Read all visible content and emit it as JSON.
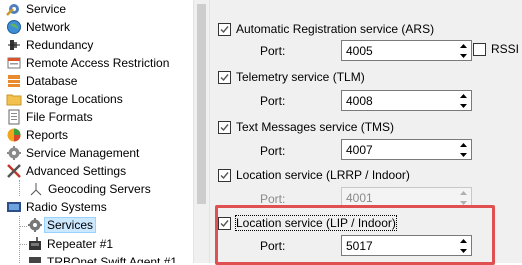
{
  "tree": {
    "items": [
      {
        "label": "Service",
        "icon": "gear-icon"
      },
      {
        "label": "Network",
        "icon": "globe-icon"
      },
      {
        "label": "Redundancy",
        "icon": "redundancy-icon"
      },
      {
        "label": "Remote Access Restriction",
        "icon": "remote-access-icon"
      },
      {
        "label": "Database",
        "icon": "database-icon"
      },
      {
        "label": "Storage Locations",
        "icon": "folder-icon"
      },
      {
        "label": "File Formats",
        "icon": "file-icon"
      },
      {
        "label": "Reports",
        "icon": "reports-icon"
      },
      {
        "label": "Service Management",
        "icon": "gear-icon"
      },
      {
        "label": "Advanced Settings",
        "icon": "tools-icon"
      },
      {
        "label": "Geocoding Servers",
        "icon": "geocoding-icon"
      },
      {
        "label": "Radio Systems",
        "icon": "radio-system-icon"
      },
      {
        "label": "Services",
        "icon": "gear-icon"
      },
      {
        "label": "Repeater #1",
        "icon": "repeater-icon"
      },
      {
        "label": "TRBOnet Swift Agent #1",
        "icon": "agent-icon"
      }
    ]
  },
  "services": [
    {
      "label": "Automatic Registration service (ARS)",
      "checked": true,
      "port_label": "Port:",
      "port": "4005",
      "port_enabled": true
    },
    {
      "label": "Telemetry service (TLM)",
      "checked": true,
      "port_label": "Port:",
      "port": "4008",
      "port_enabled": true
    },
    {
      "label": "Text Messages service (TMS)",
      "checked": true,
      "port_label": "Port:",
      "port": "4007",
      "port_enabled": true
    },
    {
      "label": "Location service (LRRP / Indoor)",
      "checked": true,
      "port_label": "Port:",
      "port": "4001",
      "port_enabled": false
    },
    {
      "label": "Location service (LIP / Indoor)",
      "checked": true,
      "port_label": "Port:",
      "port": "5017",
      "port_enabled": true
    }
  ],
  "rssi": {
    "label": "RSSI",
    "checked": false
  },
  "colors": {
    "highlight": "#e05050",
    "panel_bg": "#f0f0f0",
    "selection": "#cce8ff"
  }
}
